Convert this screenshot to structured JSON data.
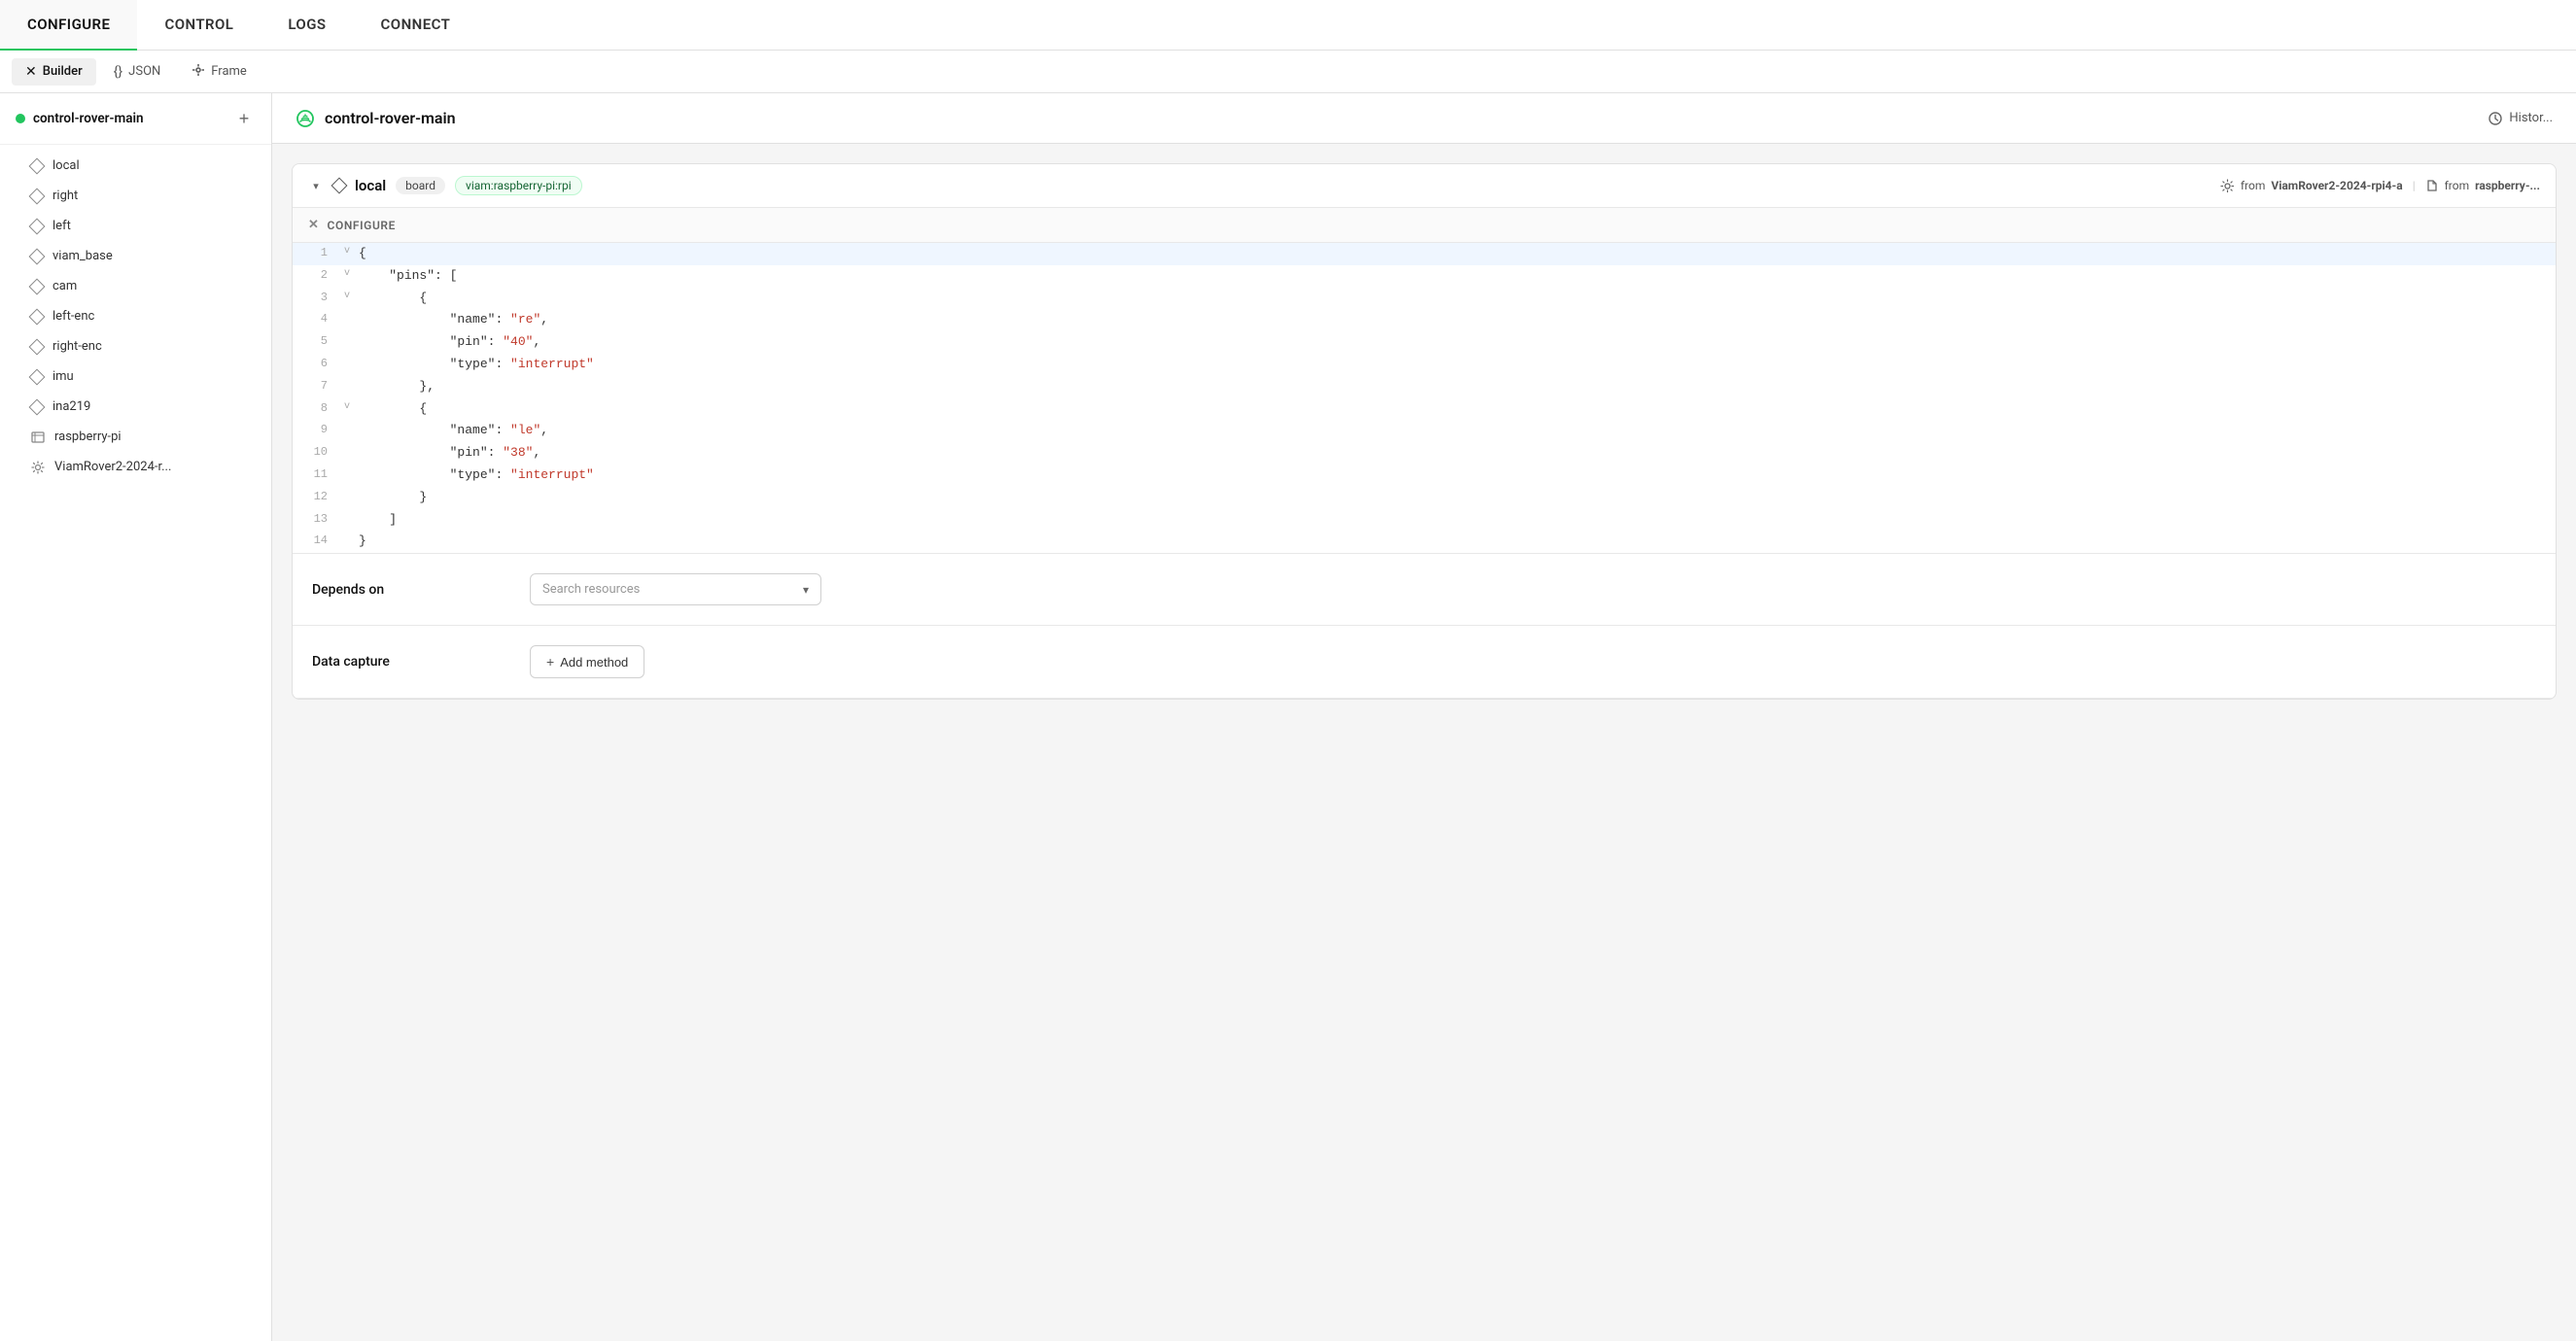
{
  "topNav": {
    "items": [
      {
        "id": "configure",
        "label": "CONFIGURE",
        "active": true
      },
      {
        "id": "control",
        "label": "CONTROL",
        "active": false
      },
      {
        "id": "logs",
        "label": "LOGS",
        "active": false
      },
      {
        "id": "connect",
        "label": "CONNECT",
        "active": false
      }
    ]
  },
  "subNav": {
    "items": [
      {
        "id": "builder",
        "label": "Builder",
        "icon": "✕",
        "active": true
      },
      {
        "id": "json",
        "label": "JSON",
        "icon": "{}",
        "active": false
      },
      {
        "id": "frame",
        "label": "Frame",
        "icon": "⊹",
        "active": false
      }
    ]
  },
  "sidebar": {
    "robotName": "control-rover-main",
    "addLabel": "+",
    "items": [
      {
        "id": "local",
        "label": "local",
        "type": "diamond",
        "active": false
      },
      {
        "id": "right",
        "label": "right",
        "type": "diamond",
        "active": false
      },
      {
        "id": "left",
        "label": "left",
        "type": "diamond",
        "active": false
      },
      {
        "id": "viam_base",
        "label": "viam_base",
        "type": "diamond",
        "active": false
      },
      {
        "id": "cam",
        "label": "cam",
        "type": "diamond",
        "active": false
      },
      {
        "id": "left-enc",
        "label": "left-enc",
        "type": "diamond",
        "active": false
      },
      {
        "id": "right-enc",
        "label": "right-enc",
        "type": "diamond",
        "active": false
      },
      {
        "id": "imu",
        "label": "imu",
        "type": "diamond",
        "active": false
      },
      {
        "id": "ina219",
        "label": "ina219",
        "type": "diamond",
        "active": false
      },
      {
        "id": "raspberry-pi",
        "label": "raspberry-pi",
        "type": "board",
        "active": false
      },
      {
        "id": "viamrover",
        "label": "ViamRover2-2024-r...",
        "type": "gear",
        "active": false
      }
    ]
  },
  "contentHeader": {
    "title": "control-rover-main",
    "historyLabel": "Histor..."
  },
  "componentCard": {
    "name": "local",
    "tag": "board",
    "tagType": "viam:raspberry-pi:rpi",
    "fromLabel1": "from",
    "fromSource1": "ViamRover2-2024-rpi4-a",
    "fromLabel2": "from",
    "fromSource2": "raspberry-..."
  },
  "configureSection": {
    "label": "CONFIGURE",
    "code": {
      "lines": [
        {
          "num": 1,
          "toggle": "v",
          "content": "{",
          "highlighted": true
        },
        {
          "num": 2,
          "toggle": "v",
          "content": "    \"pins\": ["
        },
        {
          "num": 3,
          "toggle": "v",
          "content": "        {"
        },
        {
          "num": 4,
          "toggle": "",
          "content": "            \"name\": \"re\","
        },
        {
          "num": 5,
          "toggle": "",
          "content": "            \"pin\": \"40\","
        },
        {
          "num": 6,
          "toggle": "",
          "content": "            \"type\": \"interrupt\""
        },
        {
          "num": 7,
          "toggle": "",
          "content": "        },"
        },
        {
          "num": 8,
          "toggle": "v",
          "content": "        {"
        },
        {
          "num": 9,
          "toggle": "",
          "content": "            \"name\": \"le\","
        },
        {
          "num": 10,
          "toggle": "",
          "content": "            \"pin\": \"38\","
        },
        {
          "num": 11,
          "toggle": "",
          "content": "            \"type\": \"interrupt\""
        },
        {
          "num": 12,
          "toggle": "",
          "content": "        }"
        },
        {
          "num": 13,
          "toggle": "",
          "content": "    ]"
        },
        {
          "num": 14,
          "toggle": "",
          "content": "}"
        }
      ]
    }
  },
  "dependsOn": {
    "label": "Depends on",
    "searchPlaceholder": "Search resources",
    "chevron": "▾"
  },
  "dataCapture": {
    "label": "Data capture",
    "addMethodLabel": "+ Add method"
  }
}
